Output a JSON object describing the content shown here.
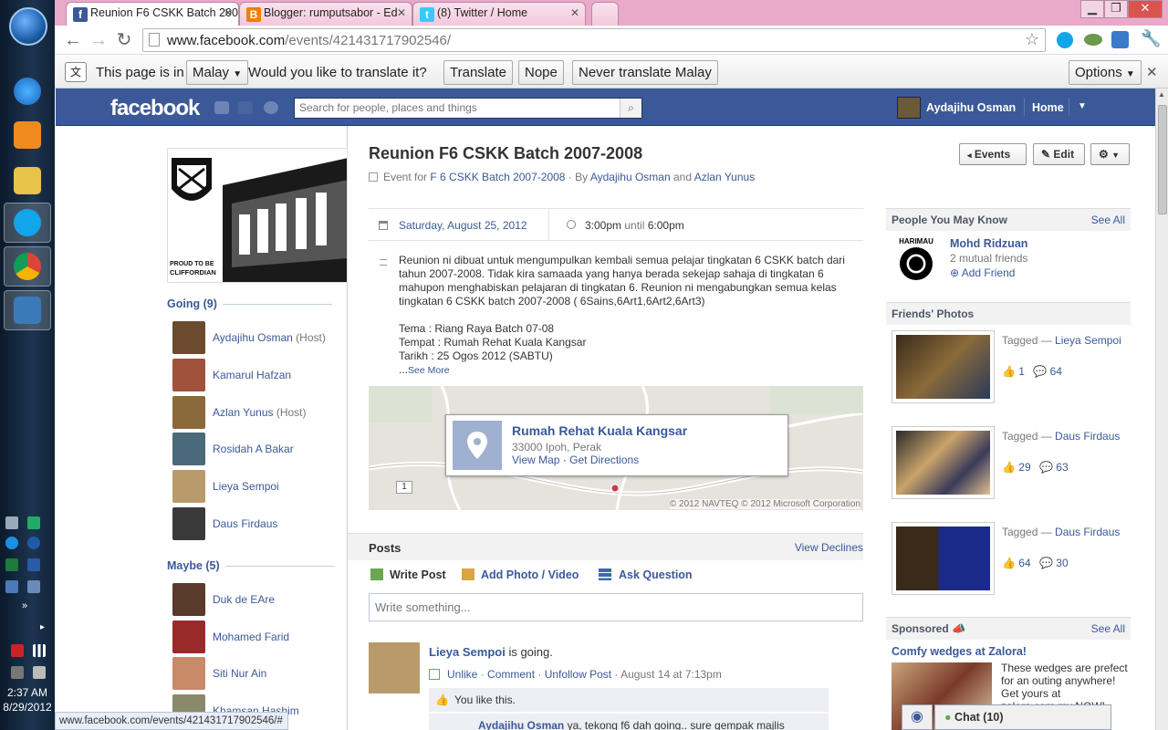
{
  "browser": {
    "tabs": [
      {
        "title": "Reunion F6 CSKK Batch 200",
        "icon": "facebook-icon",
        "color": "#3b5998",
        "glyph": "f"
      },
      {
        "title": "Blogger: rumputsabor - Ed",
        "icon": "blogger-icon",
        "color": "#f57d00",
        "glyph": "B"
      },
      {
        "title": "(8) Twitter / Home",
        "icon": "twitter-icon",
        "color": "#33ccff",
        "glyph": "t"
      }
    ],
    "url_host": "www.facebook.com",
    "url_path": "/events/421431717902546/",
    "status_url": "www.facebook.com/events/421431717902546/#"
  },
  "translate_bar": {
    "prefix": "This page is in",
    "language": "Malay",
    "question": "Would you like to translate it?",
    "translate": "Translate",
    "nope": "Nope",
    "never": "Never translate Malay",
    "options": "Options"
  },
  "fb": {
    "logo": "facebook",
    "search_placeholder": "Search for people, places and things",
    "user_name": "Aydajihu Osman",
    "home": "Home"
  },
  "event": {
    "title": "Reunion F6 CSKK Batch 2007-2008",
    "sub_prefix": "Event for",
    "group": "F 6 CSKK Batch 2007-2008",
    "by": "· By",
    "host1": "Aydajihu Osman",
    "and": "and",
    "host2": "Azlan Yunus",
    "btn_events": "Events",
    "btn_edit": "Edit",
    "date": "Saturday, August 25, 2012",
    "time_start": "3:00pm",
    "until": "until",
    "time_end": "6:00pm",
    "desc1": "Reunion ni dibuat untuk mengumpulkan kembali semua pelajar tingkatan 6 CSKK batch dari tahun 2007-2008. Tidak kira samaada yang hanya berada sekejap sahaja di tingkatan 6 mahupon menghabiskan pelajaran di tingkatan 6. Reunion ni mengabungkan semua kelas tingkatan 6 CSKK batch 2007-2008 ( 6Sains,6Art1,6Art2,6Art3)",
    "desc_tema": "Tema : Riang Raya Batch 07-08",
    "desc_tempat": "Tempat : Rumah Rehat Kuala Kangsar",
    "desc_tarikh": "Tarikh : 25 Ogos 2012 (SABTU)",
    "see_more": "See More",
    "venue": "Rumah Rehat Kuala Kangsar",
    "venue_addr": "33000 Ipoh, Perak",
    "view_map": "View Map",
    "get_directions": "Get Directions",
    "map_copyright": "© 2012 NAVTEQ © 2012 Microsoft Corporation",
    "map_route": "1"
  },
  "left": {
    "cover_caption1": "PROUD TO BE",
    "cover_caption2": "CLIFFORDIAN",
    "going_label": "Going (9)",
    "going": [
      {
        "name": "Aydajihu Osman",
        "host": "(Host)",
        "color": "#6b4a2e"
      },
      {
        "name": "Kamarul Hafzan",
        "host": "",
        "color": "#a0523c"
      },
      {
        "name": "Azlan Yunus",
        "host": "(Host)",
        "color": "#8a6a3a"
      },
      {
        "name": "Rosidah A Bakar",
        "host": "",
        "color": "#4a6a7a"
      },
      {
        "name": "Lieya Sempoi",
        "host": "",
        "color": "#b99a6a"
      },
      {
        "name": "Daus Firdaus",
        "host": "",
        "color": "#3a3a3a"
      }
    ],
    "maybe_label": "Maybe (5)",
    "maybe": [
      {
        "name": "Duk de EAre",
        "color": "#5a3a2a"
      },
      {
        "name": "Mohamed Farid",
        "color": "#9a2a2a"
      },
      {
        "name": "Siti Nur Ain",
        "color": "#c98a6a"
      },
      {
        "name": "Khamsan Hashim",
        "color": "#8a8a6a"
      }
    ]
  },
  "posts": {
    "header": "Posts",
    "view_declines": "View Declines",
    "write_post": "Write Post",
    "add_photo": "Add Photo / Video",
    "ask_question": "Ask Question",
    "placeholder": "Write something...",
    "story_author": "Lieya Sempoi",
    "story_text": "is going.",
    "unlike": "Unlike",
    "comment": "Comment",
    "unfollow": "Unfollow Post",
    "time": "August 14 at 7:13pm",
    "you_like": "You like this.",
    "comment_author": "Aydajihu Osman",
    "comment_text": "ya, tekong f6 dah going.. sure gempak majlis"
  },
  "right": {
    "pymk_title": "People You May Know",
    "see_all": "See All",
    "pymk_name": "Mohd Ridzuan",
    "pymk_mutual": "2 mutual friends",
    "pymk_add": "Add Friend",
    "pymk_badge": "HARIMAU",
    "photos_title": "Friends' Photos",
    "tagged": "Tagged —",
    "photos": [
      {
        "who": "Lieya Sempoi",
        "likes": "1",
        "comments": "64",
        "color": "#5a4a2a"
      },
      {
        "who": "Daus Firdaus",
        "likes": "29",
        "comments": "63",
        "color": "#6a5a3a"
      },
      {
        "who": "Daus Firdaus",
        "likes": "64",
        "comments": "30",
        "color": "#1a2a7a"
      }
    ],
    "sponsored_title": "Sponsored",
    "ad_title": "Comfy wedges at Zalora!",
    "ad_text": "These wedges are prefect for an outing anywhere! Get yours at zalora.com.my NOW!"
  },
  "chat": {
    "label": "Chat (10)"
  },
  "taskbar": {
    "time": "2:37 AM",
    "date": "8/29/2012"
  }
}
